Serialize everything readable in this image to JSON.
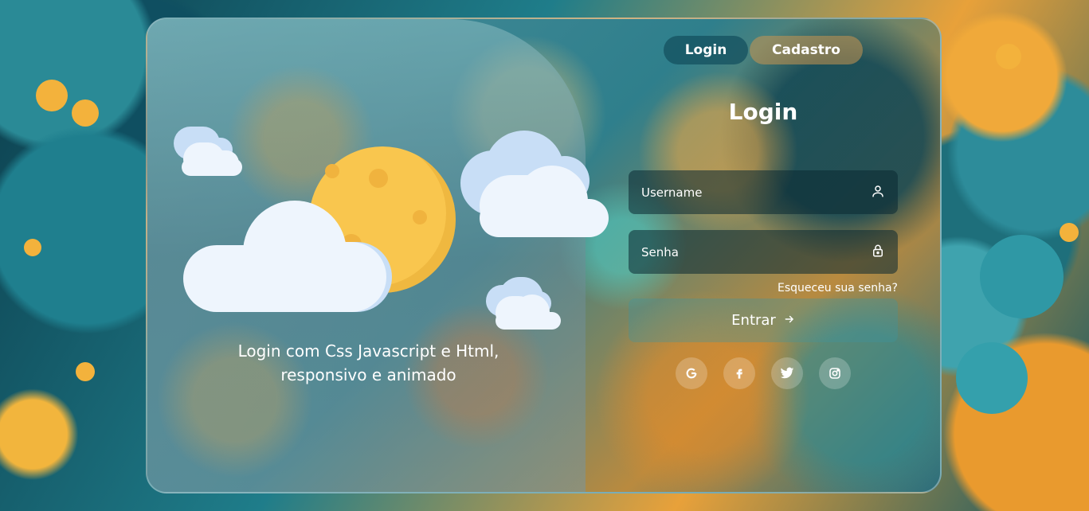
{
  "tabs": {
    "login_label": "Login",
    "signup_label": "Cadastro"
  },
  "form": {
    "title": "Login",
    "username_placeholder": "Username",
    "password_placeholder": "Senha",
    "forgot_label": "Esqueceu sua senha?",
    "submit_label": "Entrar",
    "username_icon": "user-icon",
    "password_icon": "lock-icon",
    "submit_icon": "arrow-right-icon"
  },
  "hero": {
    "tagline": "Login com Css Javascript e Html, responsivo e animado"
  },
  "socials": [
    {
      "name": "google",
      "icon": "google-icon"
    },
    {
      "name": "facebook",
      "icon": "facebook-icon"
    },
    {
      "name": "twitter",
      "icon": "twitter-icon"
    },
    {
      "name": "instagram",
      "icon": "instagram-icon"
    }
  ],
  "colors": {
    "sun": "#f9c64e",
    "cloud": "#eef5fd",
    "cloud_shadow": "#c8def6",
    "tab_active": "#145f6e",
    "tab_inactive": "#c8964f"
  }
}
